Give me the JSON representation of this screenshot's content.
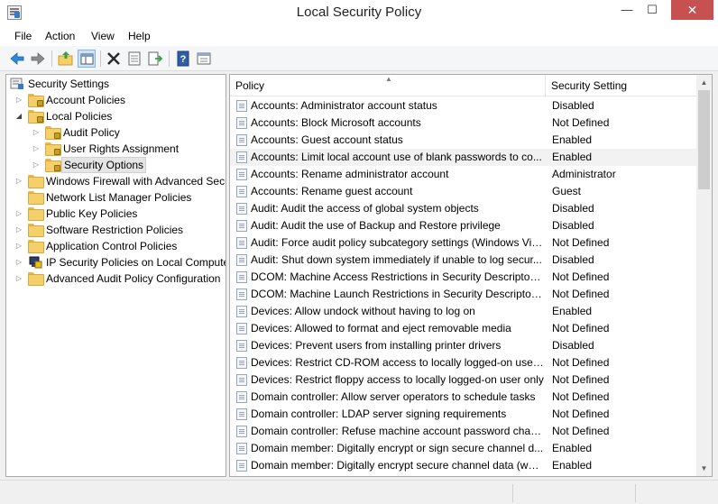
{
  "window": {
    "title": "Local Security Policy",
    "controls": {
      "minimize": "—",
      "maximize": "☐",
      "close": "✕"
    }
  },
  "menu": [
    "File",
    "Action",
    "View",
    "Help"
  ],
  "toolbar_icons": [
    "back-arrow-icon",
    "forward-arrow-icon",
    "up-folder-icon",
    "show-hide-tree-icon",
    "delete-icon",
    "properties-icon",
    "export-list-icon",
    "help-icon",
    "view-icon"
  ],
  "tree": [
    {
      "label": "Security Settings",
      "level": 0,
      "toggle": "",
      "icon": "security-settings-icon"
    },
    {
      "label": "Account Policies",
      "level": 1,
      "toggle": "▷",
      "icon": "folder-lock-icon"
    },
    {
      "label": "Local Policies",
      "level": 1,
      "toggle": "◢",
      "icon": "folder-lock-icon"
    },
    {
      "label": "Audit Policy",
      "level": 2,
      "toggle": "▷",
      "icon": "folder-lock-icon"
    },
    {
      "label": "User Rights Assignment",
      "level": 2,
      "toggle": "▷",
      "icon": "folder-lock-icon"
    },
    {
      "label": "Security Options",
      "level": 2,
      "toggle": "▷",
      "icon": "folder-lock-icon",
      "selected": true
    },
    {
      "label": "Windows Firewall with Advanced Secu",
      "level": 1,
      "toggle": "▷",
      "icon": "folder-icon"
    },
    {
      "label": "Network List Manager Policies",
      "level": 1,
      "toggle": "",
      "icon": "folder-icon"
    },
    {
      "label": "Public Key Policies",
      "level": 1,
      "toggle": "▷",
      "icon": "folder-icon"
    },
    {
      "label": "Software Restriction Policies",
      "level": 1,
      "toggle": "▷",
      "icon": "folder-icon"
    },
    {
      "label": "Application Control Policies",
      "level": 1,
      "toggle": "▷",
      "icon": "folder-icon"
    },
    {
      "label": "IP Security Policies on Local Compute",
      "level": 1,
      "toggle": "▷",
      "icon": "ip-security-icon"
    },
    {
      "label": "Advanced Audit Policy Configuration",
      "level": 1,
      "toggle": "▷",
      "icon": "folder-icon"
    }
  ],
  "columns": {
    "policy": "Policy",
    "setting": "Security Setting"
  },
  "rows": [
    {
      "policy": "Accounts: Administrator account status",
      "setting": "Disabled"
    },
    {
      "policy": "Accounts: Block Microsoft accounts",
      "setting": "Not Defined"
    },
    {
      "policy": "Accounts: Guest account status",
      "setting": "Enabled"
    },
    {
      "policy": "Accounts: Limit local account use of blank passwords to co...",
      "setting": "Enabled",
      "highlighted": true
    },
    {
      "policy": "Accounts: Rename administrator account",
      "setting": "Administrator"
    },
    {
      "policy": "Accounts: Rename guest account",
      "setting": "Guest"
    },
    {
      "policy": "Audit: Audit the access of global system objects",
      "setting": "Disabled"
    },
    {
      "policy": "Audit: Audit the use of Backup and Restore privilege",
      "setting": "Disabled"
    },
    {
      "policy": "Audit: Force audit policy subcategory settings (Windows Vis...",
      "setting": "Not Defined"
    },
    {
      "policy": "Audit: Shut down system immediately if unable to log secur...",
      "setting": "Disabled"
    },
    {
      "policy": "DCOM: Machine Access Restrictions in Security Descriptor D...",
      "setting": "Not Defined"
    },
    {
      "policy": "DCOM: Machine Launch Restrictions in Security Descriptor ...",
      "setting": "Not Defined"
    },
    {
      "policy": "Devices: Allow undock without having to log on",
      "setting": "Enabled"
    },
    {
      "policy": "Devices: Allowed to format and eject removable media",
      "setting": "Not Defined"
    },
    {
      "policy": "Devices: Prevent users from installing printer drivers",
      "setting": "Disabled"
    },
    {
      "policy": "Devices: Restrict CD-ROM access to locally logged-on user ...",
      "setting": "Not Defined"
    },
    {
      "policy": "Devices: Restrict floppy access to locally logged-on user only",
      "setting": "Not Defined"
    },
    {
      "policy": "Domain controller: Allow server operators to schedule tasks",
      "setting": "Not Defined"
    },
    {
      "policy": "Domain controller: LDAP server signing requirements",
      "setting": "Not Defined"
    },
    {
      "policy": "Domain controller: Refuse machine account password chan...",
      "setting": "Not Defined"
    },
    {
      "policy": "Domain member: Digitally encrypt or sign secure channel d...",
      "setting": "Enabled"
    },
    {
      "policy": "Domain member: Digitally encrypt secure channel data (whe...",
      "setting": "Enabled"
    }
  ],
  "scroll": {
    "up": "▲",
    "down": "▼",
    "position_fraction": 0.0
  }
}
